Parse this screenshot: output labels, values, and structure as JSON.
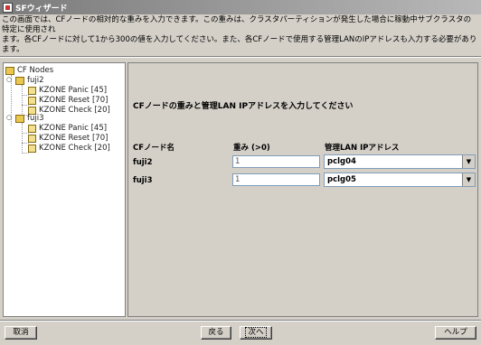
{
  "window": {
    "title": "SFウィザード"
  },
  "description": {
    "line1": "この画面では、CFノードの相対的な重みを入力できます。この重みは、クラスタパーティションが発生した場合に稼動中サブクラスタの特定に使用され",
    "line2": "ます。各CFノードに対して1から300の値を入力してください。また、各CFノードで使用する管理LANのIPアドレスも入力する必要があります。"
  },
  "tree": {
    "root": "CF Nodes",
    "nodes": [
      {
        "name": "fuji2",
        "children": [
          "KZONE Panic [45]",
          "KZONE Reset [70]",
          "KZONE Check [20]"
        ]
      },
      {
        "name": "fuji3",
        "children": [
          "KZONE Panic [45]",
          "KZONE Reset [70]",
          "KZONE Check [20]"
        ]
      }
    ]
  },
  "main": {
    "heading": "CFノードの重みと管理LAN IPアドレスを入力してください",
    "columns": {
      "node": "CFノード名",
      "weight": "重み (>0)",
      "ip": "管理LAN IPアドレス"
    },
    "rows": [
      {
        "node": "fuji2",
        "weight": "1",
        "ip": "pclg04"
      },
      {
        "node": "fuji3",
        "weight": "1",
        "ip": "pclg05"
      }
    ]
  },
  "buttons": {
    "cancel": "取消",
    "back": "戻る",
    "next": "次へ",
    "help": "ヘルプ"
  }
}
